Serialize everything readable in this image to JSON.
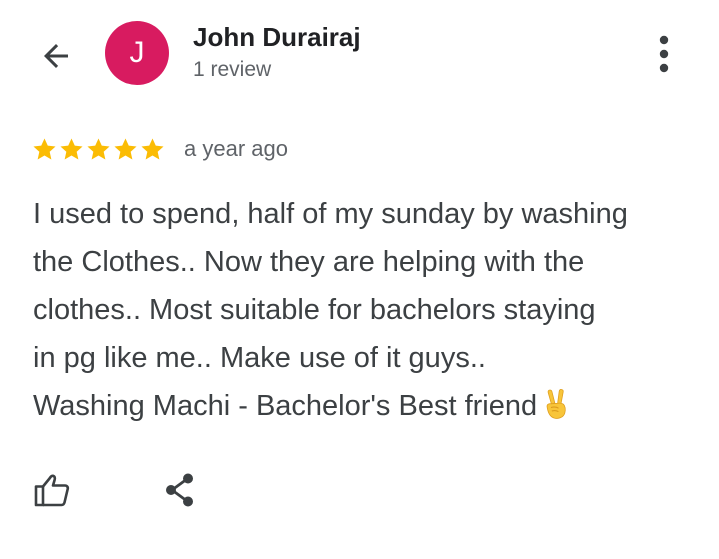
{
  "header": {
    "back_icon": "arrow-left-icon",
    "avatar_letter": "J",
    "avatar_color": "#d81b60",
    "author_name": "John Durairaj",
    "review_count": "1 review",
    "more_icon": "more-vertical-icon"
  },
  "review": {
    "rating": 5,
    "max_rating": 5,
    "star_color": "#fbbc04",
    "time": "a year ago",
    "lines": [
      "I used to spend, half of my sunday by washing",
      "the Clothes.. Now they are helping with the",
      "clothes.. Most suitable for bachelors staying",
      "in pg like me.. Make use of it guys..",
      "Washing Machi - Bachelor's Best friend"
    ],
    "emoji": "victory-hand-emoji"
  },
  "actions": {
    "like_icon": "thumb-up-icon",
    "share_icon": "share-icon"
  }
}
